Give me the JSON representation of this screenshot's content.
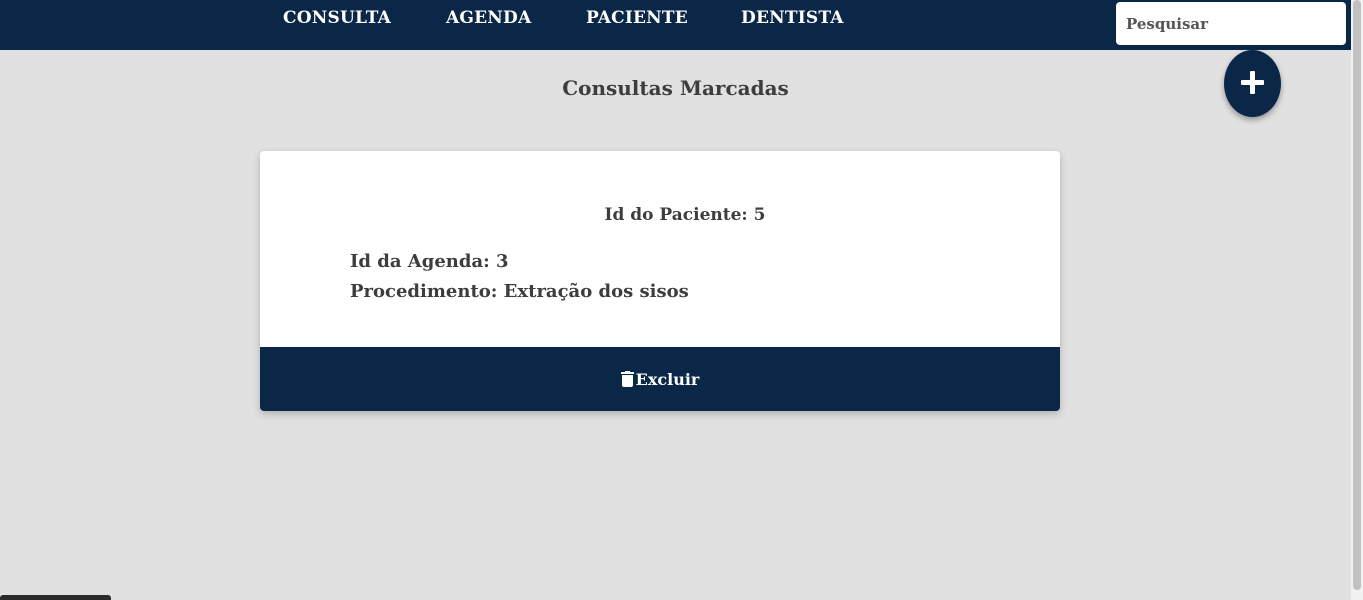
{
  "nav": {
    "items": [
      {
        "label": "CONSULTA"
      },
      {
        "label": "AGENDA"
      },
      {
        "label": "PACIENTE"
      },
      {
        "label": "DENTISTA"
      }
    ],
    "search_placeholder": "Pesquisar"
  },
  "page": {
    "title": "Consultas Marcadas",
    "add_icon": "plus-icon"
  },
  "card": {
    "patient_id": "Id do Paciente: 5",
    "agenda_id": "Id da Agenda: 3",
    "procedure": "Procedimento: Extração dos sisos",
    "delete_label": "Excluir",
    "delete_icon": "trash-icon"
  },
  "colors": {
    "primary": "#0b2747",
    "background": "#e1e1e1",
    "card": "#ffffff",
    "text": "#3d3d3d"
  }
}
